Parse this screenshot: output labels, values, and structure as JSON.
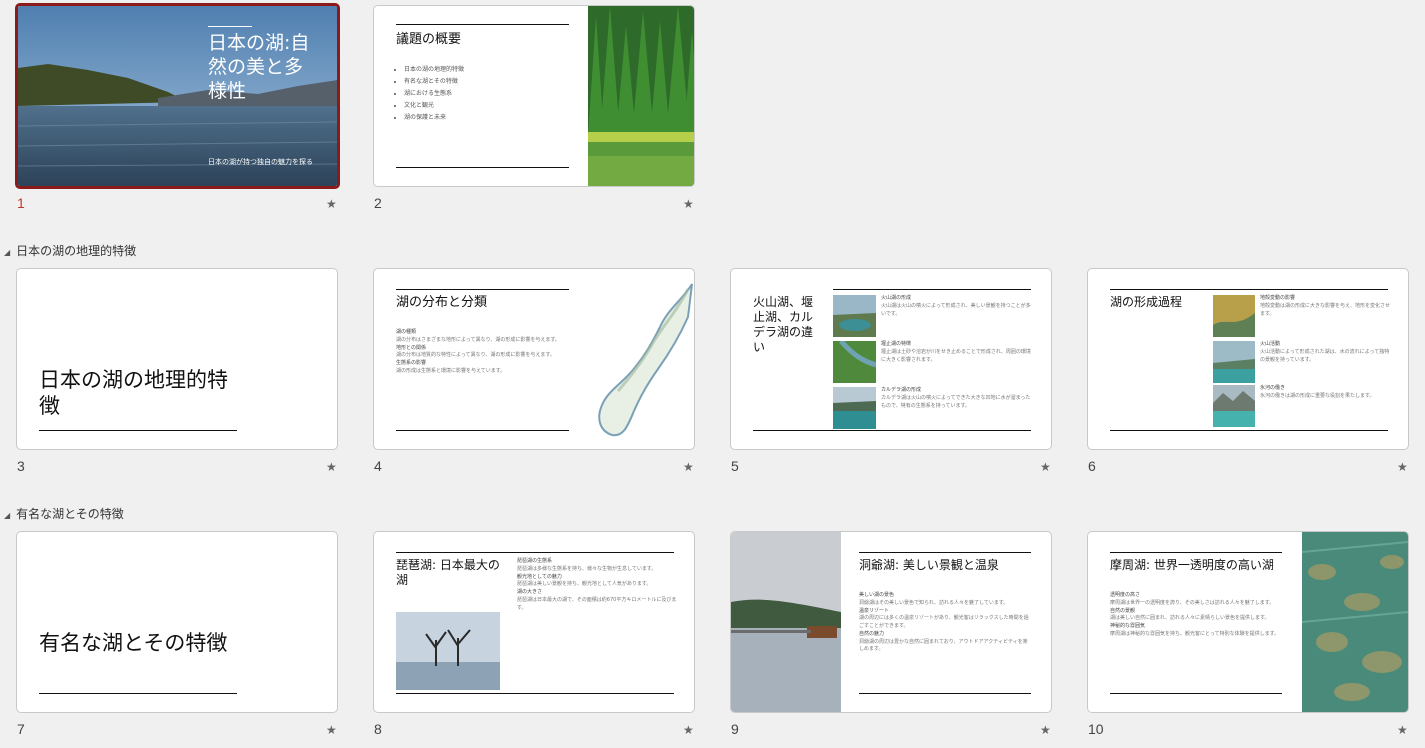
{
  "sections": [
    {
      "label": "日本の湖の地理的特徴"
    },
    {
      "label": "有名な湖とその特徴"
    }
  ],
  "slides": [
    {
      "number": "1",
      "title": "日本の湖:自然の美と多様性",
      "subtitle": "日本の湖が持つ独自の魅力を探る"
    },
    {
      "number": "2",
      "title": "議題の概要",
      "bullets": [
        "日本の湖の地理的特徴",
        "有名な湖とその特徴",
        "湖における生態系",
        "文化と観光",
        "湖の保護と未来"
      ]
    },
    {
      "number": "3",
      "title": "日本の湖の地理的特徴"
    },
    {
      "number": "4",
      "title": "湖の分布と分類",
      "items": [
        "湖の種類",
        "湖の分布はさまざまな地形によって異なり、湖の形成に影響を与えます。",
        "地形との関係",
        "湖の分布は地質的な特性によって異なり、湖の形成に影響を与えます。",
        "生態系の影響",
        "湖の形成は生態系と環境に影響を与えています。"
      ]
    },
    {
      "number": "5",
      "title": "火山湖、堰止湖、カルデラ湖の違い",
      "items": [
        "火山湖の形成",
        "火山湖は火山の噴火によって形成され、美しい景観を持つことが多いです。",
        "堰止湖の特徴",
        "堰止湖は土砂や溶岩が川をせき止めることで形成され、周囲の環境に大きく影響されます。",
        "カルデラ湖の形成",
        "カルデラ湖は火山の噴火によってできた大きな凹地に水が溜まったもので、特有の生態系を持っています。"
      ]
    },
    {
      "number": "6",
      "title": "湖の形成過程",
      "items": [
        "地殻変動の影響",
        "地殻変動は湖の形成に大きな影響を与え、地形を変化させます。",
        "火山活動",
        "火山活動によって形成された湖は、水の流れによって独特の景観を持っています。",
        "氷河の働き",
        "氷河の働きは湖の形成に重要な役割を果たします。"
      ]
    },
    {
      "number": "7",
      "title": "有名な湖とその特徴"
    },
    {
      "number": "8",
      "title": "琵琶湖: 日本最大の湖",
      "items": [
        "琵琶湖の生態系",
        "琵琶湖は多様な生態系を持ち、様々な生物が生息しています。",
        "観光地としての魅力",
        "琵琶湖は美しい景観を持ち、観光地として人気があります。",
        "湖の大きさ",
        "琵琶湖は日本最大の湖で、その面積は約670平方キロメートルに及びます。"
      ]
    },
    {
      "number": "9",
      "title": "洞爺湖: 美しい景観と温泉",
      "items": [
        "美しい湖の景色",
        "洞爺湖はその美しい景色で知られ、訪れる人々を魅了しています。",
        "温泉リゾート",
        "湖の周辺には多くの温泉リゾートがあり、観光客はリラックスした時間を過ごすことができます。",
        "自然の魅力",
        "洞爺湖の周辺は豊かな自然に囲まれており、アウトドアアクティビティを楽しめます。"
      ]
    },
    {
      "number": "10",
      "title": "摩周湖: 世界一透明度の高い湖",
      "items": [
        "透明度の高さ",
        "摩周湖は世界一の透明度を誇り、その美しさは訪れる人々を魅了します。",
        "自然の景観",
        "湖は美しい自然に囲まれ、訪れる人々に素晴らしい景色を提供します。",
        "神秘的な雰囲気",
        "摩周湖は神秘的な雰囲気を持ち、観光客にとって特別な体験を提供します。"
      ]
    }
  ],
  "star_glyph": "★",
  "colors": {
    "selected_border": "#8b1a1a",
    "selected_number": "#c0392b"
  }
}
